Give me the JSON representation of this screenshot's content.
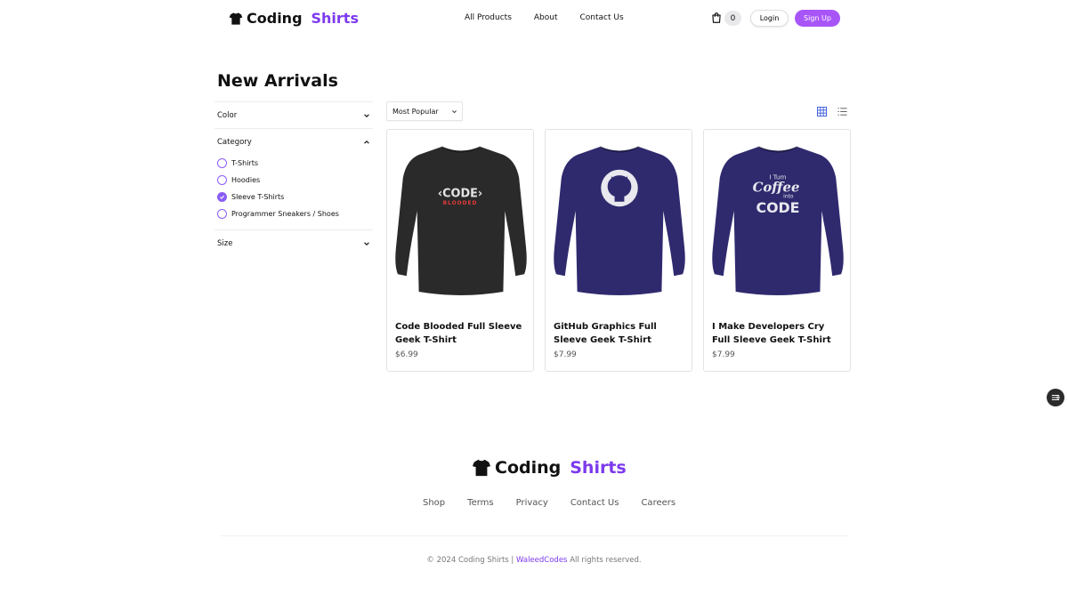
{
  "brand": {
    "name_main": "Coding",
    "name_accent": "Shirts",
    "accent_color": "#7c3aed",
    "button_color": "#a855f7"
  },
  "nav": {
    "items": [
      "All Products",
      "About",
      "Contact Us"
    ]
  },
  "header": {
    "cart_count": "0",
    "login_label": "Login",
    "signup_label": "Sign Up"
  },
  "page": {
    "title": "New Arrivals"
  },
  "filters": {
    "color_label": "Color",
    "category_label": "Category",
    "size_label": "Size",
    "categories": [
      {
        "label": "T-Shirts",
        "checked": false
      },
      {
        "label": "Hoodies",
        "checked": false
      },
      {
        "label": "Sleeve T-Shirts",
        "checked": true
      },
      {
        "label": "Programmer Sneakers / Shoes",
        "checked": false
      }
    ]
  },
  "sort": {
    "selected": "Most Popular"
  },
  "products": [
    {
      "name": "Code Blooded Full Sleeve Geek T-Shirt",
      "price": "$6.99",
      "shirt_color": "#2a2a2a",
      "print_lines": [
        "‹CODE›",
        "BLOODED"
      ]
    },
    {
      "name": "GitHub Graphics Full Sleeve Geek T-Shirt",
      "price": "$7.99",
      "shirt_color": "#2f2a6e",
      "print_lines": []
    },
    {
      "name": "I Make Developers Cry Full Sleeve Geek T-Shirt",
      "price": "$7.99",
      "shirt_color": "#2f2a6e",
      "print_lines": [
        "I Turn",
        "Coffee",
        "into",
        "CODE"
      ]
    }
  ],
  "footer": {
    "links": [
      "Shop",
      "Terms",
      "Privacy",
      "Contact Us",
      "Careers"
    ],
    "copyright_prefix": "© 2024 Coding Shirts |",
    "author": "WaleedCodes",
    "copyright_suffix": "All rights reserved."
  },
  "icons": {
    "logo": "tshirt-icon",
    "cart": "cart-icon",
    "grid": "grid-view-icon",
    "list": "list-view-icon",
    "floating": "filter-toggle-icon"
  }
}
